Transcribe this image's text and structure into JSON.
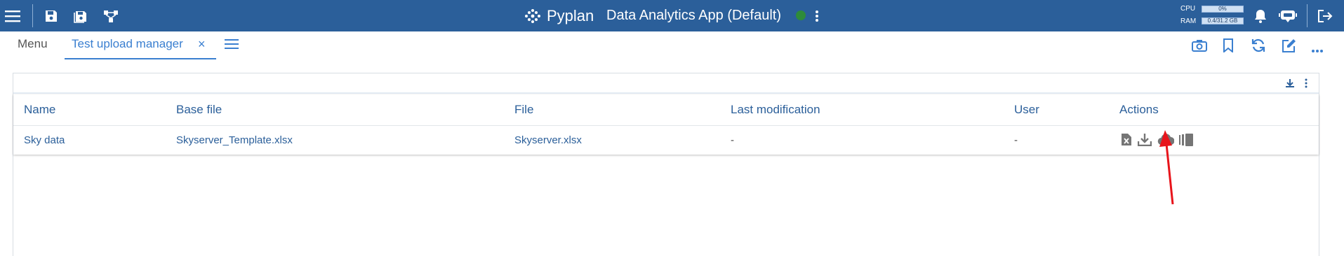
{
  "topbar": {
    "brand": "Pyplan",
    "app_title": "Data Analytics App (Default)",
    "cpu_label": "CPU",
    "cpu_value": "0%",
    "ram_label": "RAM",
    "ram_value": "0.4/31.2 GB",
    "status_color": "#2e8b3a"
  },
  "tabs": {
    "menu_label": "Menu",
    "active_label": "Test upload manager",
    "close_glyph": "×"
  },
  "table": {
    "columns": [
      "Name",
      "Base file",
      "File",
      "Last modification",
      "User",
      "Actions"
    ],
    "rows": [
      {
        "name": "Sky data",
        "base_file": "Skyserver_Template.xlsx",
        "file": "Skyserver.xlsx",
        "last_modification": "-",
        "user": "-"
      }
    ],
    "action_icons": [
      "excel-file-icon",
      "download-icon",
      "cloud-upload-icon",
      "columns-icon"
    ]
  },
  "annotation": {
    "arrow_color": "#e8141b",
    "points_to": "cloud-upload-icon"
  }
}
